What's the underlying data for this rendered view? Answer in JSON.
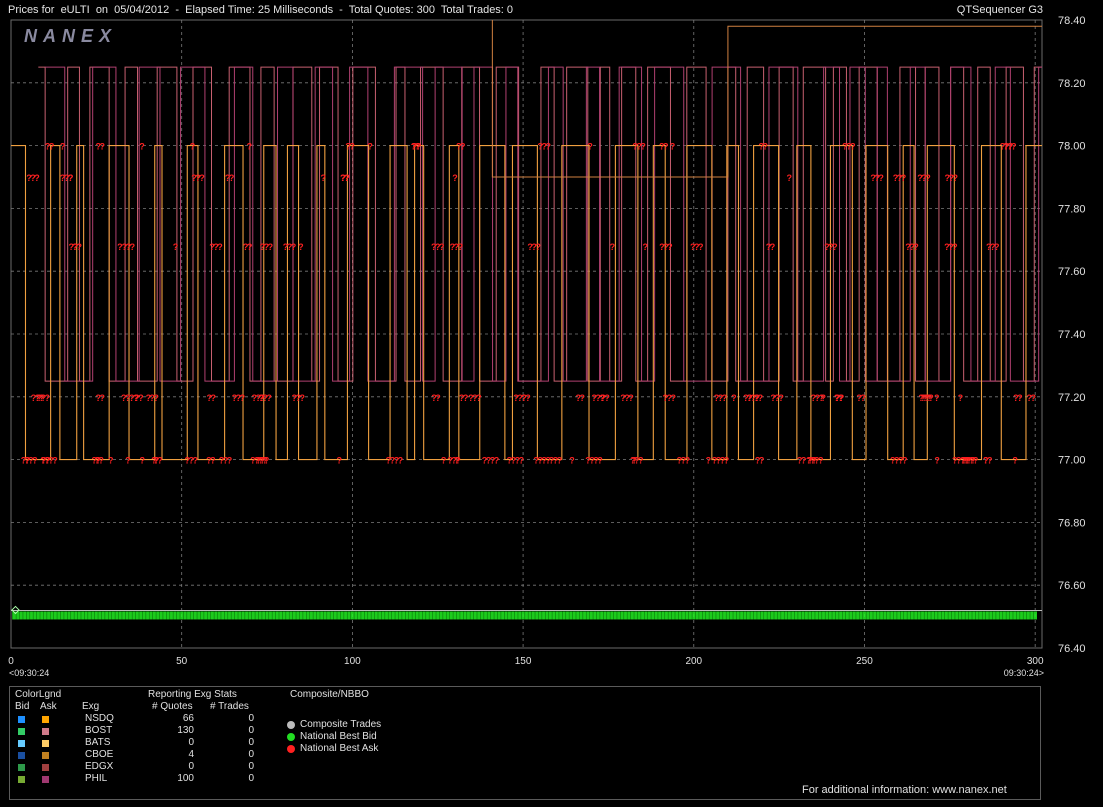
{
  "header": {
    "title": "Prices for  eULTI  on  05/04/2012  -  Elapsed Time: 25 Milliseconds  -  Total Quotes: 300  Total Trades: 0",
    "app_name": "QTSequencer G3",
    "watermark": "NANEX"
  },
  "chart_data": {
    "type": "line",
    "xlabel": "",
    "ylabel": "",
    "xlim": [
      0,
      302
    ],
    "ylim": [
      76.4,
      78.4
    ],
    "x_ticks": [
      0,
      50,
      100,
      150,
      200,
      250,
      300
    ],
    "y_ticks": [
      "78.40",
      "78.20",
      "78.00",
      "77.80",
      "77.60",
      "77.40",
      "77.20",
      "77.00",
      "76.80",
      "76.60",
      "76.40"
    ],
    "time_start": "<09:30:24",
    "time_end": "09:30:24>",
    "grid": true,
    "price_levels": {
      "ask_high": 78.25,
      "ask_mid": 78.0,
      "ask_low": 77.25,
      "bid_high": 78.0,
      "bid_low": 77.0,
      "questions_upper": 77.68,
      "questions_mid": 77.2,
      "questions_low": 77.0,
      "national_best_bid": 76.51,
      "top_step": 78.38
    },
    "series": [
      {
        "name": "BOST Ask",
        "color": "#c86070"
      },
      {
        "name": "NSDQ Ask",
        "color": "#f0a040"
      },
      {
        "name": "PHIL Ask",
        "color": "#b04070"
      },
      {
        "name": "National Best Bid",
        "color": "#22ee22"
      },
      {
        "name": "National Best Ask",
        "color": "#ff2020"
      }
    ]
  },
  "legend": {
    "color_legend_title": "ColorLgnd",
    "bid_header": "Bid",
    "ask_header": "Ask",
    "exchange_header": "Exg",
    "stats_title": "Reporting Exg Stats",
    "quotes_header": "# Quotes",
    "trades_header": "# Trades",
    "composite_title": "Composite/NBBO",
    "exchanges": [
      {
        "name": "NSDQ",
        "quotes": "66",
        "trades": "0",
        "bid_color": "#1e90ff",
        "ask_color": "#ffa500"
      },
      {
        "name": "BOST",
        "quotes": "130",
        "trades": "0",
        "bid_color": "#33cc66",
        "ask_color": "#d07a8a"
      },
      {
        "name": "BATS",
        "quotes": "0",
        "trades": "0",
        "bid_color": "#66ccff",
        "ask_color": "#ffcc66"
      },
      {
        "name": "CBOE",
        "quotes": "4",
        "trades": "0",
        "bid_color": "#1a4fa0",
        "ask_color": "#c08020"
      },
      {
        "name": "EDGX",
        "quotes": "0",
        "trades": "0",
        "bid_color": "#2e9a4a",
        "ask_color": "#a04040"
      },
      {
        "name": "PHIL",
        "quotes": "100",
        "trades": "0",
        "bid_color": "#77aa33",
        "ask_color": "#a03870"
      }
    ],
    "composite_items": [
      {
        "label": "Composite Trades",
        "color": "#bbbbbb"
      },
      {
        "label": "National Best Bid",
        "color": "#22dd22"
      },
      {
        "label": "National Best Ask",
        "color": "#ff2020"
      }
    ],
    "footer": "For additional information: www.nanex.net"
  }
}
